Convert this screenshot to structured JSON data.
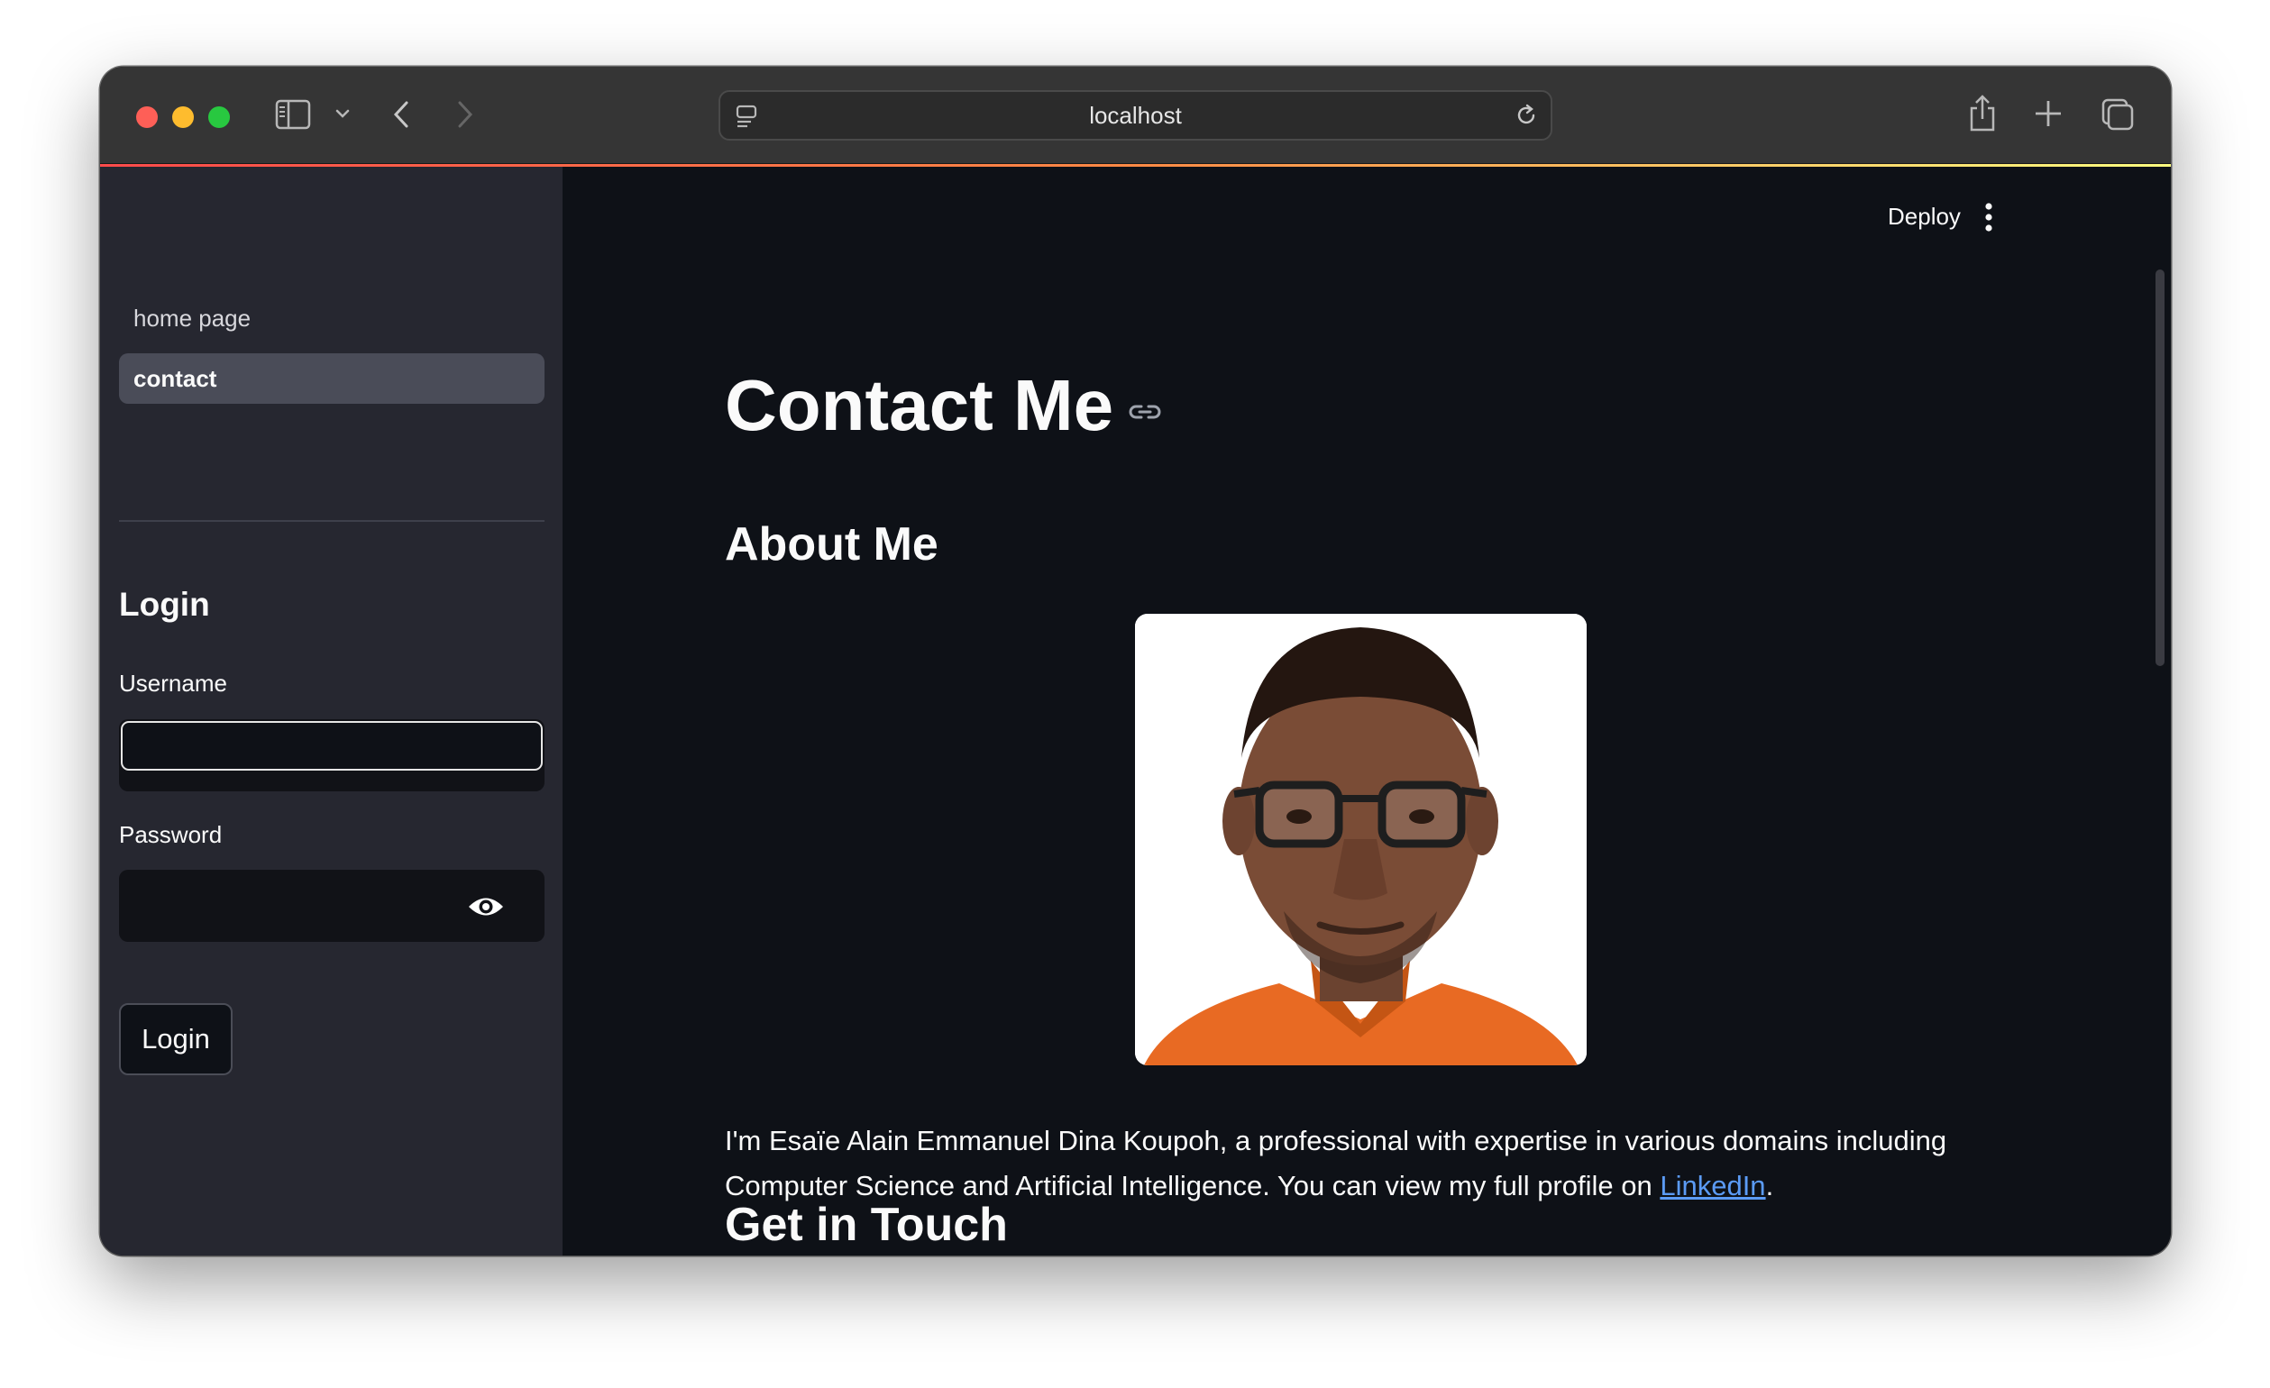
{
  "browser": {
    "url": "localhost",
    "icons": [
      "sidebar-toggle-icon",
      "chevron-down-icon",
      "back-arrow-icon",
      "forward-arrow-icon",
      "site-settings-icon",
      "reload-icon",
      "share-icon",
      "new-tab-icon",
      "tab-overview-icon"
    ]
  },
  "sidebar": {
    "nav": [
      {
        "label": "home page",
        "selected": false
      },
      {
        "label": "contact",
        "selected": true
      }
    ],
    "login": {
      "heading": "Login",
      "username_label": "Username",
      "username_value": "",
      "password_label": "Password",
      "password_value": "",
      "button_label": "Login"
    }
  },
  "header": {
    "deploy_label": "Deploy"
  },
  "main": {
    "title": "Contact Me",
    "about_heading": "About Me",
    "photo_alt": "Portrait photo",
    "bio_text": "I'm Esaïe Alain Emmanuel Dina Koupoh, a professional with expertise in various domains including Computer Science and Artificial Intelligence. You can view my full profile on ",
    "bio_link": "LinkedIn",
    "bio_end": ".",
    "touch_heading": "Get in Touch"
  },
  "colors": {
    "background": "#0e1117",
    "sidebar": "#262730",
    "link": "#5b9bf6",
    "selected_nav": "#4a4c58"
  }
}
